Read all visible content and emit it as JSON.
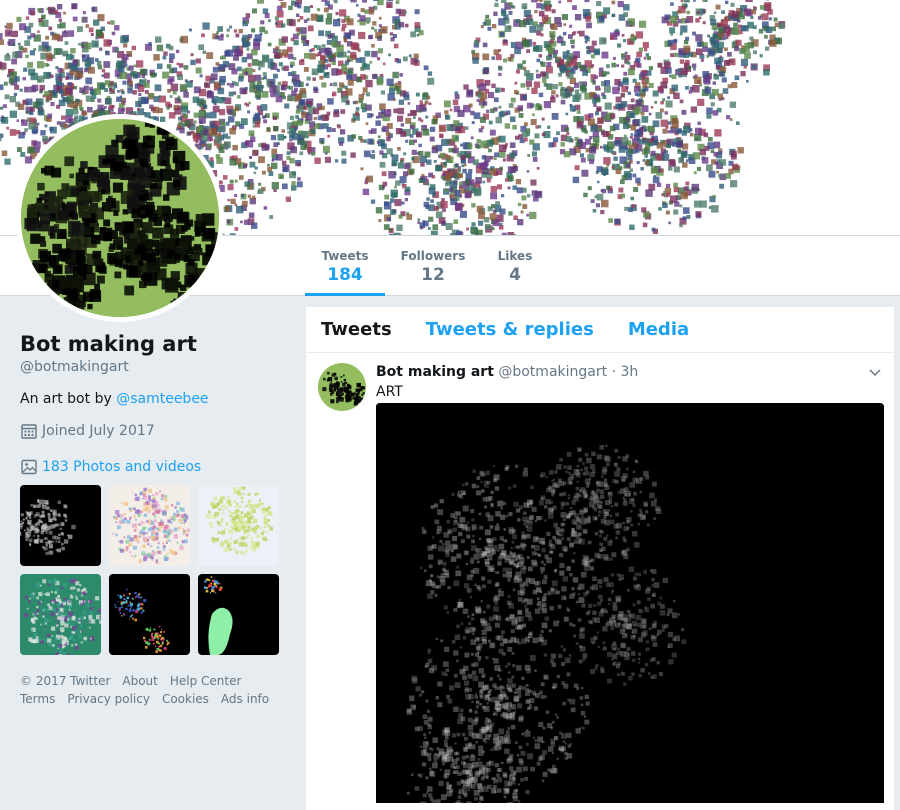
{
  "profile": {
    "name": "Bot making art",
    "handle": "@botmakingart",
    "bio_prefix": "An art bot by ",
    "bio_link": "@samteebee",
    "joined": "Joined July 2017",
    "photos_label": "183 Photos and videos"
  },
  "nav": {
    "stats": [
      {
        "label": "Tweets",
        "value": "184"
      },
      {
        "label": "Followers",
        "value": "12"
      },
      {
        "label": "Likes",
        "value": "4"
      }
    ]
  },
  "footer": {
    "row1": [
      "© 2017 Twitter",
      "About",
      "Help Center"
    ],
    "row2": [
      "Terms",
      "Privacy policy",
      "Cookies",
      "Ads info"
    ]
  },
  "timeline": {
    "tabs": [
      "Tweets",
      "Tweets & replies",
      "Media"
    ],
    "tweet": {
      "name": "Bot making art",
      "handle": "@botmakingart",
      "time": "· 3h",
      "text": "ART"
    }
  },
  "colors": {
    "accent": "#1da1f2",
    "page_bg": "#e6ecf0",
    "muted": "#657786",
    "avatar_green": "#93bd5f"
  },
  "icons": [
    "calendar-icon",
    "photo-icon",
    "chevron-down-icon"
  ]
}
